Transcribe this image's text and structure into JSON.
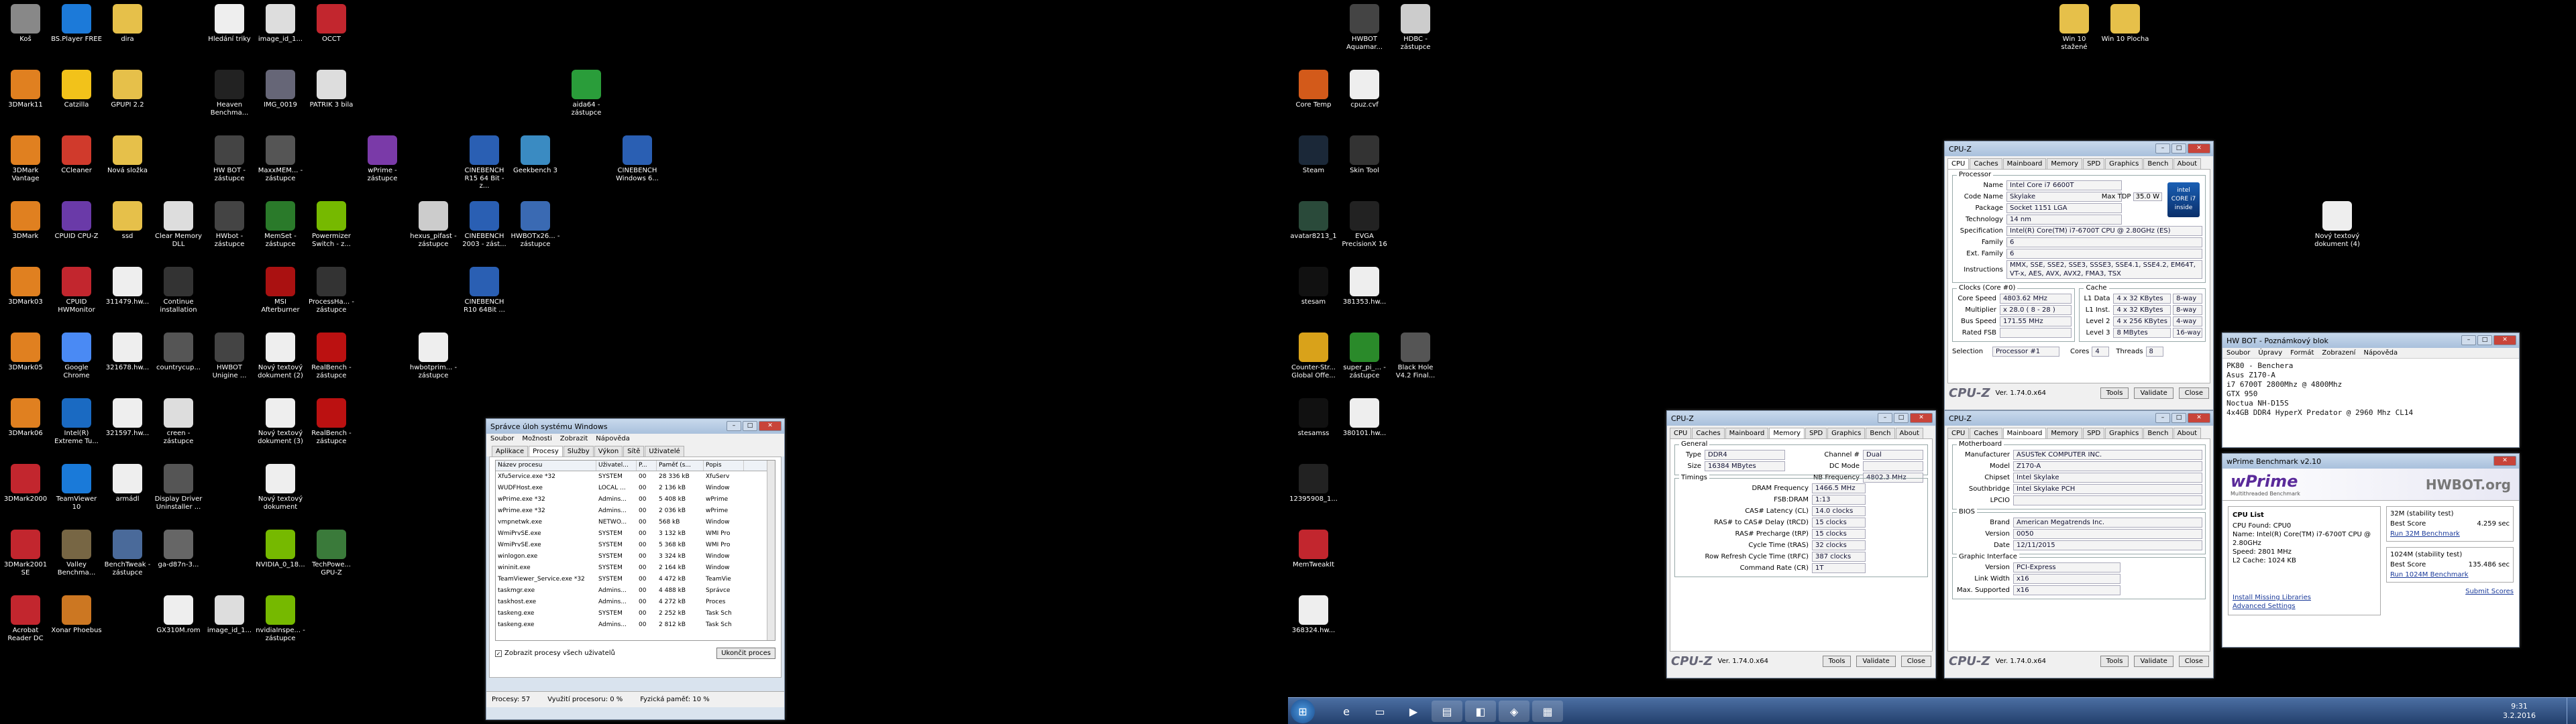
{
  "desktop_left": [
    {
      "label": "Koš",
      "c": "#888"
    },
    {
      "label": "BS.Player FREE",
      "c": "#1c7ad9"
    },
    {
      "label": "dira",
      "c": "#e6c04a"
    },
    {
      "label": "Hledání triky",
      "c": "#eee"
    },
    {
      "label": "image_id_1...",
      "c": "#ddd"
    },
    {
      "label": "OCCT",
      "c": "#c2262e"
    },
    {
      "label": "3DMark11",
      "c": "#e08020"
    },
    {
      "label": "Catzilla",
      "c": "#f2c21a"
    },
    {
      "label": "GPUPI 2.2",
      "c": "#e6c04a"
    },
    {
      "label": "Heaven Benchma...",
      "c": "#222"
    },
    {
      "label": "IMG_0019",
      "c": "#667"
    },
    {
      "label": "PATRIK 3 bila",
      "c": "#ddd"
    },
    {
      "label": "aida64 - zástupce",
      "c": "#2a9d3a"
    },
    {
      "label": "3DMark Vantage",
      "c": "#e08020"
    },
    {
      "label": "CCleaner",
      "c": "#d03a2c"
    },
    {
      "label": "Nová složka",
      "c": "#e6c04a"
    },
    {
      "label": "HW BOT - zástupce",
      "c": "#444"
    },
    {
      "label": "MaxxMEM... - zástupce",
      "c": "#555"
    },
    {
      "label": "wPrime - zástupce",
      "c": "#7a3aa8"
    },
    {
      "label": "CINEBENCH R15 64 Bit - z...",
      "c": "#2a5fb3"
    },
    {
      "label": "Geekbench 3",
      "c": "#3a8bc2"
    },
    {
      "label": "CINEBENCH Windows 6...",
      "c": "#2a5fb3"
    },
    {
      "label": "3DMark",
      "c": "#e08020"
    },
    {
      "label": "CPUID CPU-Z",
      "c": "#6a3aa8"
    },
    {
      "label": "ssd",
      "c": "#e6c04a"
    },
    {
      "label": "Clear Memory DLL",
      "c": "#ddd"
    },
    {
      "label": "HWbot - zástupce",
      "c": "#444"
    },
    {
      "label": "MemSet - zástupce",
      "c": "#2a7a2a"
    },
    {
      "label": "Powermizer Switch - z...",
      "c": "#76b900"
    },
    {
      "label": "hexus_pifast - zástupce",
      "c": "#ccc"
    },
    {
      "label": "CINEBENCH 2003 - zást...",
      "c": "#2a5fb3"
    },
    {
      "label": "HWBOTx26... - zástupce",
      "c": "#3a6ab3"
    },
    {
      "label": "3DMark03",
      "c": "#e08020"
    },
    {
      "label": "CPUID HWMonitor",
      "c": "#c2262e"
    },
    {
      "label": "311479.hw...",
      "c": "#eee"
    },
    {
      "label": "Continue installation",
      "c": "#333"
    },
    {
      "label": "MSI Afterburner",
      "c": "#a11"
    },
    {
      "label": "ProcessHa... - zástupce",
      "c": "#333"
    },
    {
      "label": "CINEBENCH R10 64Bit ...",
      "c": "#2a5fb3"
    },
    {
      "label": "3DMark05",
      "c": "#e08020"
    },
    {
      "label": "Google Chrome",
      "c": "#4a8af4"
    },
    {
      "label": "321678.hw...",
      "c": "#eee"
    },
    {
      "label": "countrycup...",
      "c": "#555"
    },
    {
      "label": "HWBOT Unigine ...",
      "c": "#444"
    },
    {
      "label": "Nový textový dokument (2)",
      "c": "#eee"
    },
    {
      "label": "RealBench - zástupce",
      "c": "#b11"
    },
    {
      "label": "hwbotprim... - zástupce",
      "c": "#eee"
    },
    {
      "label": "3DMark06",
      "c": "#e08020"
    },
    {
      "label": "Intel(R) Extreme Tu...",
      "c": "#1a6ac2"
    },
    {
      "label": "321597.hw...",
      "c": "#eee"
    },
    {
      "label": "creen - zástupce",
      "c": "#ddd"
    },
    {
      "label": "Nový textový dokument (3)",
      "c": "#eee"
    },
    {
      "label": "RealBench - zástupce",
      "c": "#b11"
    },
    {
      "label": "3DMark2000",
      "c": "#c2262e"
    },
    {
      "label": "TeamViewer 10",
      "c": "#1a7ad9"
    },
    {
      "label": "armádl",
      "c": "#eee"
    },
    {
      "label": "Display Driver Uninstaller ...",
      "c": "#555"
    },
    {
      "label": "Nový textový dokument",
      "c": "#eee"
    },
    {
      "label": "3DMark2001 SE",
      "c": "#c2262e"
    },
    {
      "label": "Valley Benchma...",
      "c": "#776644"
    },
    {
      "label": "BenchTweak - zástupce",
      "c": "#4a6a9a"
    },
    {
      "label": "ga-d87n-3...",
      "c": "#666"
    },
    {
      "label": "NVIDIA_0_18...",
      "c": "#76b900"
    },
    {
      "label": "TechPowe... GPU-Z",
      "c": "#3a7a3a"
    },
    {
      "label": "Acrobat Reader DC",
      "c": "#c2262e"
    },
    {
      "label": "Xonar Phoebus",
      "c": "#cc7722"
    },
    {
      "label": "GX310M.rom",
      "c": "#eee"
    },
    {
      "label": "image_id_1...",
      "c": "#ddd"
    },
    {
      "label": "nvidiaInspe... - zástupce",
      "c": "#76b900"
    }
  ],
  "desktop_right": [
    {
      "label": "HWBOT Aquamar...",
      "c": "#444"
    },
    {
      "label": "HDBC - zástupce",
      "c": "#ccc"
    },
    {
      "label": "Win 10 stažené",
      "c": "#e6c04a"
    },
    {
      "label": "Win 10 Plocha",
      "c": "#e6c04a"
    },
    {
      "label": "Core Temp",
      "c": "#d35a1a"
    },
    {
      "label": "cpuz.cvf",
      "c": "#eee"
    },
    {
      "label": "Steam",
      "c": "#1b2838"
    },
    {
      "label": "Skin Tool",
      "c": "#333"
    },
    {
      "label": "avatar8213_1",
      "c": "#2a4a3a"
    },
    {
      "label": "EVGA PrecisionX 16",
      "c": "#222"
    },
    {
      "label": "Nový textový dokument (4)",
      "c": "#eee"
    },
    {
      "label": "stesam",
      "c": "#111"
    },
    {
      "label": "381353.hw...",
      "c": "#eee"
    },
    {
      "label": "Counter-Str... Global Offe...",
      "c": "#d9a21a"
    },
    {
      "label": "super_pi_... - zástupce",
      "c": "#2a8a2a"
    },
    {
      "label": "Black Hole V4.2 Final...",
      "c": "#555"
    },
    {
      "label": "stesamss",
      "c": "#111"
    },
    {
      "label": "380101.hw...",
      "c": "#eee"
    },
    {
      "label": "12395908_1...",
      "c": "#222"
    },
    {
      "label": "MemTweakIt",
      "c": "#c2262e"
    },
    {
      "label": "368324.hw...",
      "c": "#eee"
    }
  ],
  "taskmgr": {
    "title": "Správce úloh systému Windows",
    "menu": [
      "Soubor",
      "Možnosti",
      "Zobrazit",
      "Nápověda"
    ],
    "tabs": [
      "Aplikace",
      "Procesy",
      "Služby",
      "Výkon",
      "Sítě",
      "Uživatelé"
    ],
    "cols": [
      "Název procesu",
      "Uživatel...",
      "P...",
      "Paměť (s...",
      "Popis"
    ],
    "rows": [
      [
        "Xfu5ervice.exe *32",
        "SYSTEM",
        "00",
        "28 336 kB",
        "XfuServ"
      ],
      [
        "WUDFHost.exe",
        "LOCAL ...",
        "00",
        "2 136 kB",
        "Window"
      ],
      [
        "wPrime.exe *32",
        "Admins...",
        "00",
        "5 408 kB",
        "wPrime"
      ],
      [
        "wPrime.exe *32",
        "Admins...",
        "00",
        "2 036 kB",
        "wPrime"
      ],
      [
        "vmpnetwk.exe",
        "NETWO...",
        "00",
        "568 kB",
        "Window"
      ],
      [
        "WmiPrvSE.exe",
        "SYSTEM",
        "00",
        "3 132 kB",
        "WMI Pro"
      ],
      [
        "WmiPrvSE.exe",
        "SYSTEM",
        "00",
        "5 368 kB",
        "WMI Pro"
      ],
      [
        "winlogon.exe",
        "SYSTEM",
        "00",
        "3 324 kB",
        "Window"
      ],
      [
        "wininit.exe",
        "SYSTEM",
        "00",
        "2 164 kB",
        "Window"
      ],
      [
        "TeamViewer_Service.exe *32",
        "SYSTEM",
        "00",
        "4 472 kB",
        "TeamVie"
      ],
      [
        "taskmgr.exe",
        "Admins...",
        "00",
        "4 488 kB",
        "Správce"
      ],
      [
        "taskhost.exe",
        "Admins...",
        "00",
        "4 272 kB",
        "Proces"
      ],
      [
        "taskeng.exe",
        "SYSTEM",
        "00",
        "2 252 kB",
        "Task Sch"
      ],
      [
        "taskeng.exe",
        "Admins...",
        "00",
        "2 812 kB",
        "Task Sch"
      ]
    ],
    "checkbox": "Zobrazit procesy všech uživatelů",
    "end_btn": "Ukončit proces",
    "status": [
      "Procesy: 57",
      "Využití procesoru: 0 %",
      "Fyzická paměť: 10 %"
    ]
  },
  "cpuz_cpu": {
    "title": "CPU-Z",
    "tabs": [
      "CPU",
      "Caches",
      "Mainboard",
      "Memory",
      "SPD",
      "Graphics",
      "Bench",
      "About"
    ],
    "proc_title": "Processor",
    "rows": [
      [
        "Name",
        "Intel Core i7 6600T"
      ],
      [
        "Code Name",
        "Skylake"
      ],
      [
        "Package",
        "Socket 1151 LGA"
      ],
      [
        "Technology",
        "14 nm"
      ],
      [
        "Specification",
        "Intel(R) Core(TM) i7-6700T CPU @ 2.80GHz (ES)"
      ],
      [
        "Family",
        "6"
      ],
      [
        "Ext. Family",
        "6"
      ],
      [
        "Instructions",
        "MMX, SSE, SSE2, SSE3, SSSE3, SSE4.1, SSE4.2, EM64T, VT-x, AES, AVX, AVX2, FMA3, TSX"
      ]
    ],
    "tdp_label": "Max TDP",
    "tdp": "35.0 W",
    "clocks_title": "Clocks (Core #0)",
    "clocks": [
      [
        "Core Speed",
        "4803.62 MHz"
      ],
      [
        "Multiplier",
        "x 28.0 ( 8 - 28 )"
      ],
      [
        "Bus Speed",
        "171.55 MHz"
      ],
      [
        "Rated FSB",
        ""
      ]
    ],
    "cache_title": "Cache",
    "cache": [
      [
        "L1 Data",
        "4 x 32 KBytes",
        "8-way"
      ],
      [
        "L1 Inst.",
        "4 x 32 KBytes",
        "8-way"
      ],
      [
        "Level 2",
        "4 x 256 KBytes",
        "4-way"
      ],
      [
        "Level 3",
        "8 MBytes",
        "16-way"
      ]
    ],
    "selection": "Processor #1",
    "cores": "4",
    "threads": "8",
    "version": "Ver. 1.74.0.x64",
    "btns": [
      "Tools",
      "Validate",
      "Close"
    ]
  },
  "cpuz_mem": {
    "title": "CPU-Z",
    "tabs": [
      "CPU",
      "Caches",
      "Mainboard",
      "Memory",
      "SPD",
      "Graphics",
      "Bench",
      "About"
    ],
    "general": [
      [
        "Type",
        "DDR4"
      ],
      [
        "Size",
        "16384 MBytes"
      ]
    ],
    "channel": "Dual",
    "nb": "4802.3 MHz",
    "timings": [
      [
        "DRAM Frequency",
        "1466.5 MHz"
      ],
      [
        "FSB:DRAM",
        "1:13"
      ],
      [
        "CAS# Latency (CL)",
        "14.0 clocks"
      ],
      [
        "RAS# to CAS# Delay (tRCD)",
        "15 clocks"
      ],
      [
        "RAS# Precharge (tRP)",
        "15 clocks"
      ],
      [
        "Cycle Time (tRAS)",
        "32 clocks"
      ],
      [
        "Row Refresh Cycle Time (tRFC)",
        "387 clocks"
      ],
      [
        "Command Rate (CR)",
        "1T"
      ]
    ],
    "version": "Ver. 1.74.0.x64",
    "btns": [
      "Tools",
      "Validate",
      "Close"
    ]
  },
  "cpuz_mb": {
    "title": "CPU-Z",
    "tabs": [
      "CPU",
      "Caches",
      "Mainboard",
      "Memory",
      "SPD",
      "Graphics",
      "Bench",
      "About"
    ],
    "mb": [
      [
        "Manufacturer",
        "ASUSTeK COMPUTER INC."
      ],
      [
        "Model",
        "Z170-A"
      ],
      [
        "Chipset",
        "Intel      Skylake"
      ],
      [
        "Southbridge",
        "Intel      Skylake PCH"
      ],
      [
        "LPCIO",
        ""
      ]
    ],
    "bios": [
      [
        "Brand",
        "American Megatrends Inc."
      ],
      [
        "Version",
        "0050"
      ],
      [
        "Date",
        "12/11/2015"
      ]
    ],
    "gfx": [
      [
        "Version",
        "PCI-Express"
      ],
      [
        "Link Width",
        "x16"
      ],
      [
        "Max. Supported",
        "x16"
      ]
    ],
    "version": "Ver. 1.74.0.x64",
    "btns": [
      "Tools",
      "Validate",
      "Close"
    ]
  },
  "notepad": {
    "title": "HW BOT - Poznámkový blok",
    "menu": [
      "Soubor",
      "Úpravy",
      "Formát",
      "Zobrazení",
      "Nápověda"
    ],
    "lines": [
      "PK80 - Benchera",
      "Asus Z170-A",
      "i7 6700T 2800Mhz @ 4800Mhz",
      "GTX 950",
      "Noctua NH-D15S",
      "4x4GB DDR4 HyperX Predator @ 2960 Mhz CL14"
    ]
  },
  "wprime": {
    "title": "wPrime Benchmark v2.10",
    "brand": "wPrime",
    "sub": "Multithreaded Benchmark",
    "hwbot": "HWBOT.org",
    "cpu_title": "CPU List",
    "cpu": [
      "CPU Found: CPU0",
      "Name:   Intel(R) Core(TM) i7-6700T CPU @",
      "2.80GHz",
      "Speed:  2801 MHz",
      "L2 Cache: 1024 KB"
    ],
    "b32": {
      "title": "32M (stability test)",
      "label": "Best Score",
      "val": "4.259 sec",
      "link": "Run 32M Benchmark"
    },
    "b1024": {
      "title": "1024M (stability test)",
      "label": "Best Score",
      "val": "135.486 sec",
      "link": "Run 1024M Benchmark"
    },
    "links": [
      "Install Missing Libraries",
      "Advanced Settings"
    ],
    "submit": "Submit Scores"
  },
  "clock": {
    "time": "9:31",
    "date": "3.2.2016"
  }
}
